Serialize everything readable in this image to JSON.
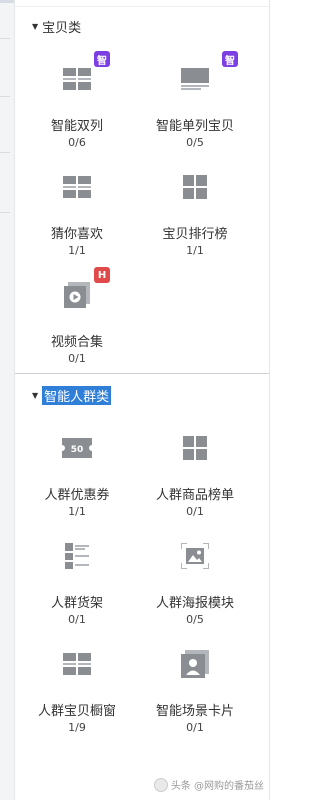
{
  "sections": [
    {
      "title": "宝贝类",
      "highlighted": false,
      "items": [
        {
          "label": "智能双列",
          "count": "0/6",
          "icon": "two-column-icon",
          "badge": "智"
        },
        {
          "label": "智能单列宝贝",
          "count": "0/5",
          "icon": "single-column-icon",
          "badge": "智"
        },
        {
          "label": "猜你喜欢",
          "count": "1/1",
          "icon": "two-column-icon",
          "badge": ""
        },
        {
          "label": "宝贝排行榜",
          "count": "1/1",
          "icon": "grid-icon",
          "badge": ""
        },
        {
          "label": "视频合集",
          "count": "0/1",
          "icon": "video-icon",
          "badge": "H"
        }
      ]
    },
    {
      "title": "智能人群类",
      "highlighted": true,
      "items": [
        {
          "label": "人群优惠券",
          "count": "1/1",
          "icon": "coupon-icon",
          "badge": ""
        },
        {
          "label": "人群商品榜单",
          "count": "0/1",
          "icon": "grid-icon",
          "badge": ""
        },
        {
          "label": "人群货架",
          "count": "0/1",
          "icon": "shelf-icon",
          "badge": ""
        },
        {
          "label": "人群海报模块",
          "count": "0/5",
          "icon": "image-icon",
          "badge": ""
        },
        {
          "label": "人群宝贝橱窗",
          "count": "1/9",
          "icon": "two-column-icon",
          "badge": ""
        },
        {
          "label": "智能场景卡片",
          "count": "0/1",
          "icon": "portrait-card-icon",
          "badge": ""
        }
      ]
    }
  ],
  "coupon_text": "50",
  "watermark": "头条 @网购的番茄丝",
  "colors": {
    "icon": "#8a8d92",
    "icon_light": "#b3b6bb",
    "badge_zhi": "#7b3fe4",
    "badge_h": "#e04a4a",
    "highlight": "#2f7ed8"
  }
}
